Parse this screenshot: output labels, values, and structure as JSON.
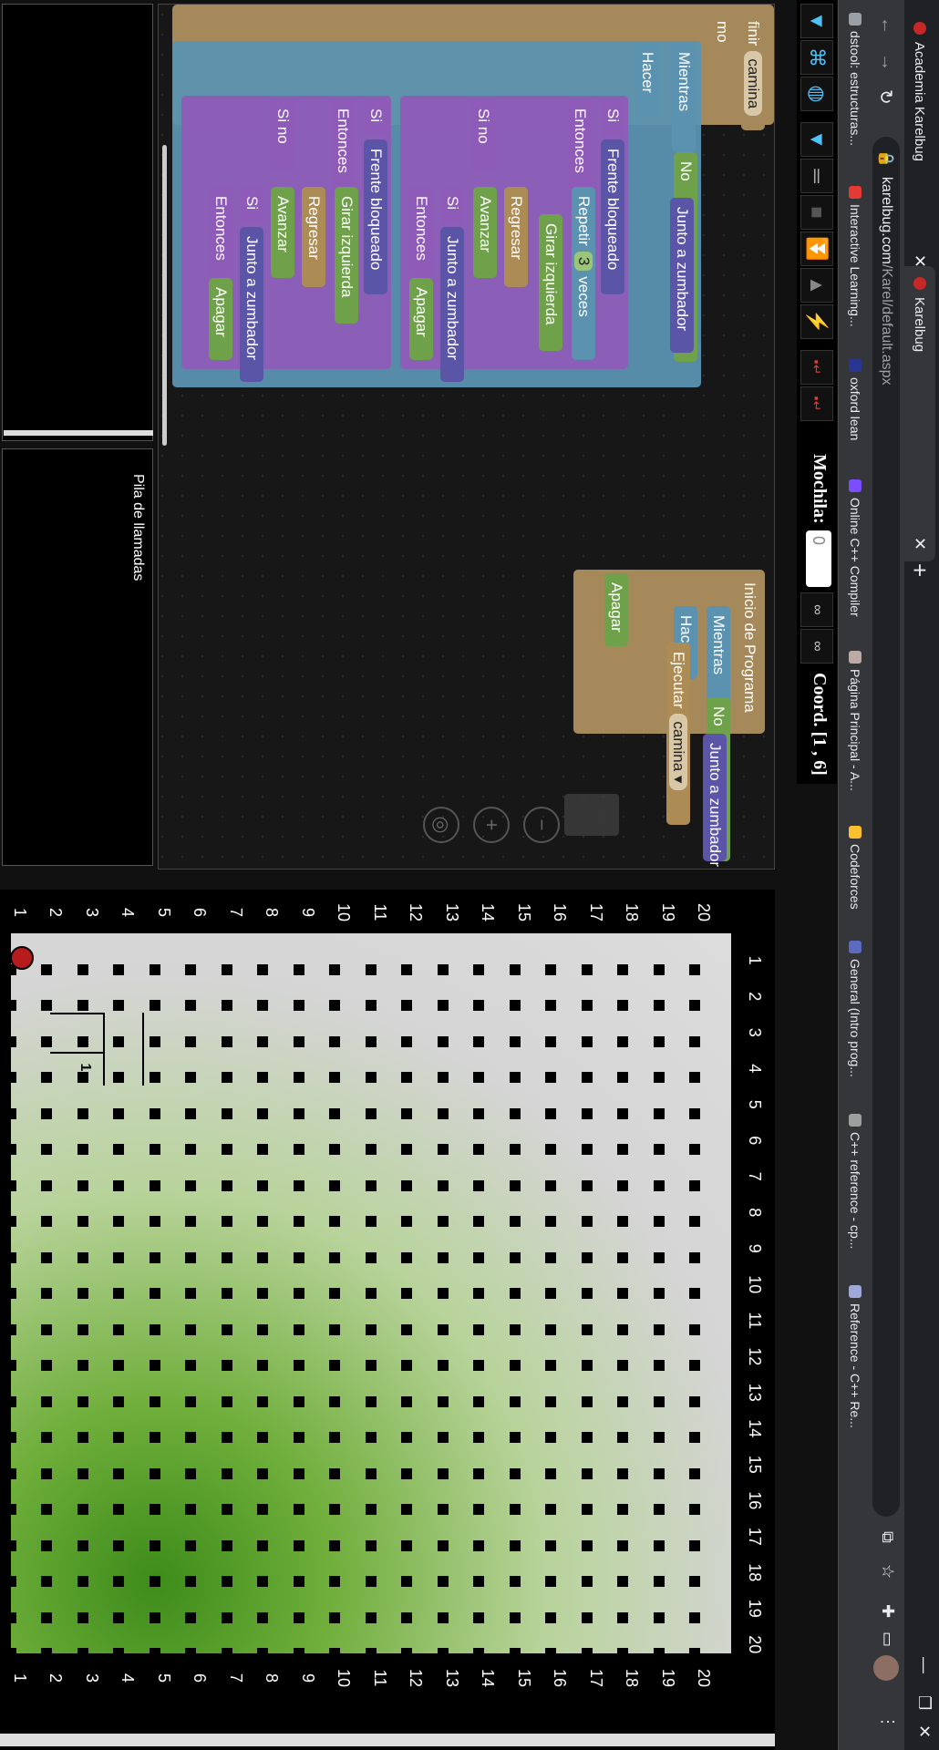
{
  "browser": {
    "tabs": [
      {
        "title": "Academia Karelbug",
        "active": false
      },
      {
        "title": "Karelbug",
        "active": true
      }
    ],
    "url_host": "karelbug.com",
    "url_path": "/Karel/default.aspx",
    "bookmarks": [
      {
        "label": "dstool: estructuras...",
        "color": "#9aa0a6"
      },
      {
        "label": "Interactive Learning...",
        "color": "#e53935"
      },
      {
        "label": "oxford lean",
        "color": "#283593"
      },
      {
        "label": "Online C++ Compiler",
        "color": "#7c4dff"
      },
      {
        "label": "Página Principal - A...",
        "color": "#bcaaa4"
      },
      {
        "label": "Codeforces",
        "color": "#fbc02d"
      },
      {
        "label": "General (Intro prog...",
        "color": "#5c6bc0"
      },
      {
        "label": "C++ reference - cp...",
        "color": "#9e9e9e"
      },
      {
        "label": "Reference - C++ Re...",
        "color": "#9fa8da"
      }
    ],
    "icons": {
      "back": "←",
      "forward": "→",
      "reload": "↻",
      "close": "✕",
      "newtab": "+"
    }
  },
  "toolbar": {
    "mochila_label": "Mochila:",
    "mochila_value": "0",
    "coord_label": "Coord. [1 , 6]"
  },
  "blocks": {
    "definir": "finir",
    "camina_name": "camina",
    "como": "mo",
    "mientras": "Mientras",
    "no": "No",
    "junto_zumbador": "Junto a zumbador",
    "hacer": "Hacer",
    "si": "Si",
    "frente_bloqueado": "Frente bloqueado",
    "entonces": "Entonces",
    "repetir": "Repetir",
    "repetir_n": "3",
    "veces": "veces",
    "girar_izquierda": "Girar izquierda",
    "regresar": "Regresar",
    "si_no": "Si no",
    "avanzar": "Avanzar",
    "apagar": "Apagar",
    "inicio_programa": "Inicio de Programa",
    "ejecutar": "Ejecutar",
    "camina_call": "camina ▾"
  },
  "panels": {
    "pila_label": "Pila de llamadas"
  },
  "world": {
    "size": 20,
    "karel": {
      "avenue": 1,
      "street": 1
    },
    "beeper": {
      "avenue": 3,
      "street": 4,
      "count": "1"
    },
    "axis_numbers": [
      "1",
      "2",
      "3",
      "4",
      "5",
      "6",
      "7",
      "8",
      "9",
      "10",
      "11",
      "12",
      "13",
      "14",
      "15",
      "16",
      "17",
      "18",
      "19",
      "20"
    ]
  }
}
